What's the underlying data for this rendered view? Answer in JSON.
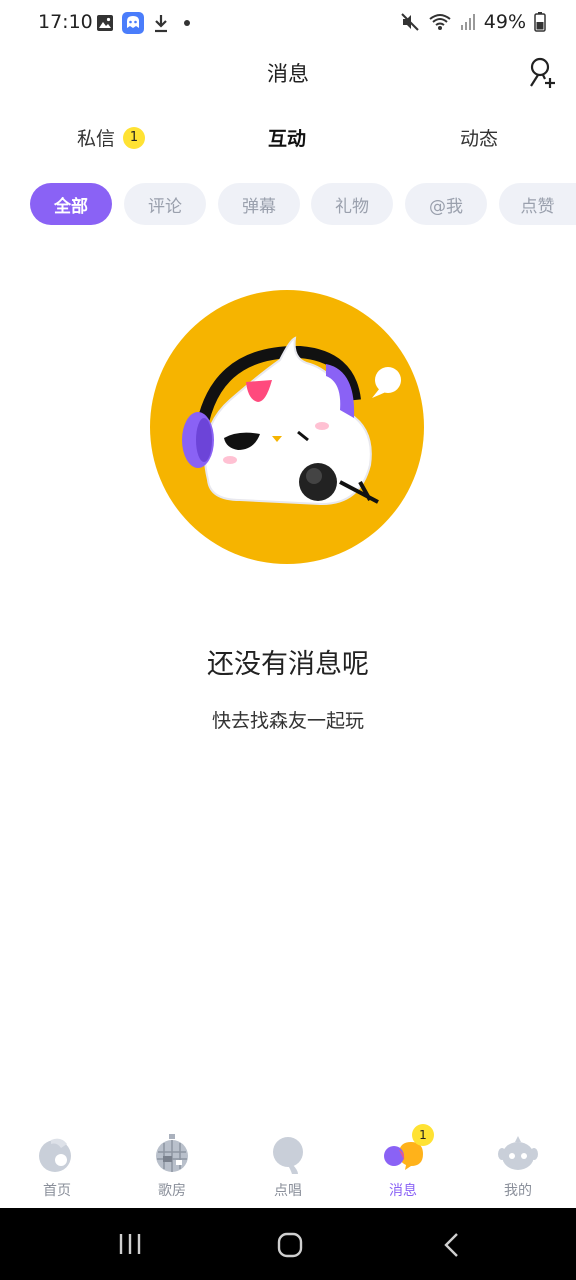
{
  "status_bar": {
    "time": "17:10",
    "battery": "49%",
    "icons_left": [
      "gallery-icon",
      "app-notification-icon",
      "download-icon",
      "dot-icon"
    ],
    "icons_right": [
      "mute-icon",
      "wifi-icon",
      "signal-icon",
      "battery-icon"
    ]
  },
  "header": {
    "title": "消息",
    "add_friend_icon": "add-friend-icon"
  },
  "tabs": [
    {
      "label": "私信",
      "badge": "1"
    },
    {
      "label": "互动",
      "active": true
    },
    {
      "label": "动态"
    }
  ],
  "filters": [
    {
      "label": "全部",
      "active": true
    },
    {
      "label": "评论"
    },
    {
      "label": "弹幕"
    },
    {
      "label": "礼物"
    },
    {
      "label": "@我"
    },
    {
      "label": "点赞"
    }
  ],
  "empty_state": {
    "title": "还没有消息呢",
    "subtitle": "快去找森友一起玩"
  },
  "bottom_nav": [
    {
      "label": "首页",
      "icon": "home-icon"
    },
    {
      "label": "歌房",
      "icon": "disco-ball-icon"
    },
    {
      "label": "点唱",
      "icon": "sing-icon"
    },
    {
      "label": "消息",
      "icon": "message-icon",
      "active": true,
      "badge": "1"
    },
    {
      "label": "我的",
      "icon": "profile-icon"
    }
  ],
  "colors": {
    "accent": "#8a62f5",
    "badge": "#ffe233",
    "mascot_bg": "#f6b400",
    "chip_bg": "#eff1f7"
  }
}
